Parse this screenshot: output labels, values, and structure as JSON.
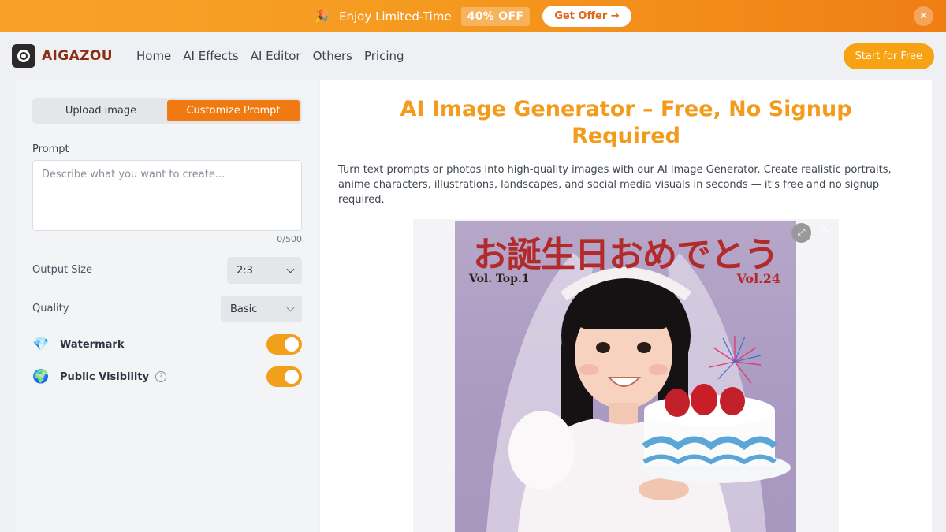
{
  "promo": {
    "emoji": "🎉",
    "text": "Enjoy Limited-Time",
    "badge": "40% OFF",
    "button": "Get Offer →",
    "close": "✕"
  },
  "nav": {
    "brand": "AIGAZOU",
    "links": [
      "Home",
      "AI Effects",
      "AI Editor",
      "Others",
      "Pricing"
    ],
    "cta": "Start for Free"
  },
  "left_panel": {
    "tabs": [
      {
        "label": "Upload image",
        "active": false
      },
      {
        "label": "Customize Prompt",
        "active": true
      }
    ],
    "prompt_label": "Prompt",
    "prompt_placeholder": "Describe what you want to create...",
    "prompt_value": "",
    "counter": "0/500",
    "output_size_label": "Output Size",
    "output_size_value": "2:3",
    "quality_label": "Quality",
    "quality_value": "Basic",
    "watermark": {
      "icon": "💎",
      "label": "Watermark",
      "on": true
    },
    "visibility": {
      "icon": "🌍",
      "label": "Public Visibility",
      "help": "?",
      "on": true
    }
  },
  "main": {
    "title": "AI Image Generator – Free, No Signup Required",
    "description": "Turn text prompts or photos into high-quality images with our AI Image Generator. Create realistic portraits, anime characters, illustrations, landscapes, and social media visuals in seconds — it's free and no signup required.",
    "poster": {
      "headline": "お誕生日おめでとう",
      "left_caption": "Vol. Top.1",
      "right_caption": "Vol.24"
    },
    "expand_icon": "⤢"
  },
  "colors": {
    "accent_orange": "#f07a12",
    "title_orange": "#f39b1d",
    "toggle_on": "#f2a01c",
    "brand_text": "#8b2e12"
  }
}
